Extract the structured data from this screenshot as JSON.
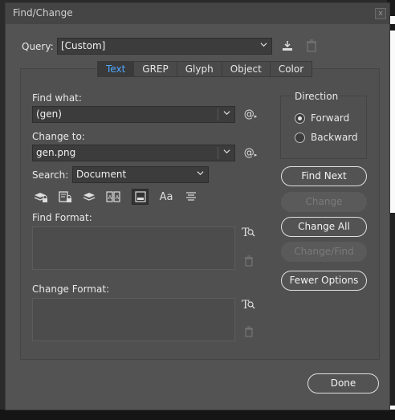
{
  "dialog": {
    "title": "Find/Change"
  },
  "query": {
    "label": "Query:",
    "value": "[Custom]"
  },
  "tabs": [
    {
      "label": "Text",
      "active": true
    },
    {
      "label": "GREP",
      "active": false
    },
    {
      "label": "Glyph",
      "active": false
    },
    {
      "label": "Object",
      "active": false
    },
    {
      "label": "Color",
      "active": false
    }
  ],
  "find_what": {
    "label": "Find what:",
    "value": "(gen)"
  },
  "change_to": {
    "label": "Change to:",
    "value": "gen.png"
  },
  "search": {
    "label": "Search:",
    "value": "Document"
  },
  "option_icons": [
    "locked-layers-icon",
    "locked-stories-icon",
    "hidden-layers-icon",
    "master-pages-icon",
    "footnotes-icon",
    "case-sensitive-icon",
    "whole-word-icon"
  ],
  "find_format": {
    "label": "Find Format:"
  },
  "change_format": {
    "label": "Change Format:"
  },
  "direction": {
    "label": "Direction",
    "forward": "Forward",
    "backward": "Backward",
    "selected": "forward"
  },
  "buttons": {
    "find_next": "Find Next",
    "change": "Change",
    "change_all": "Change All",
    "change_find": "Change/Find",
    "fewer_options": "Fewer Options",
    "done": "Done"
  },
  "special_char_symbol": "@",
  "format_text_glyph": "T",
  "case_text_glyph": "Aa"
}
